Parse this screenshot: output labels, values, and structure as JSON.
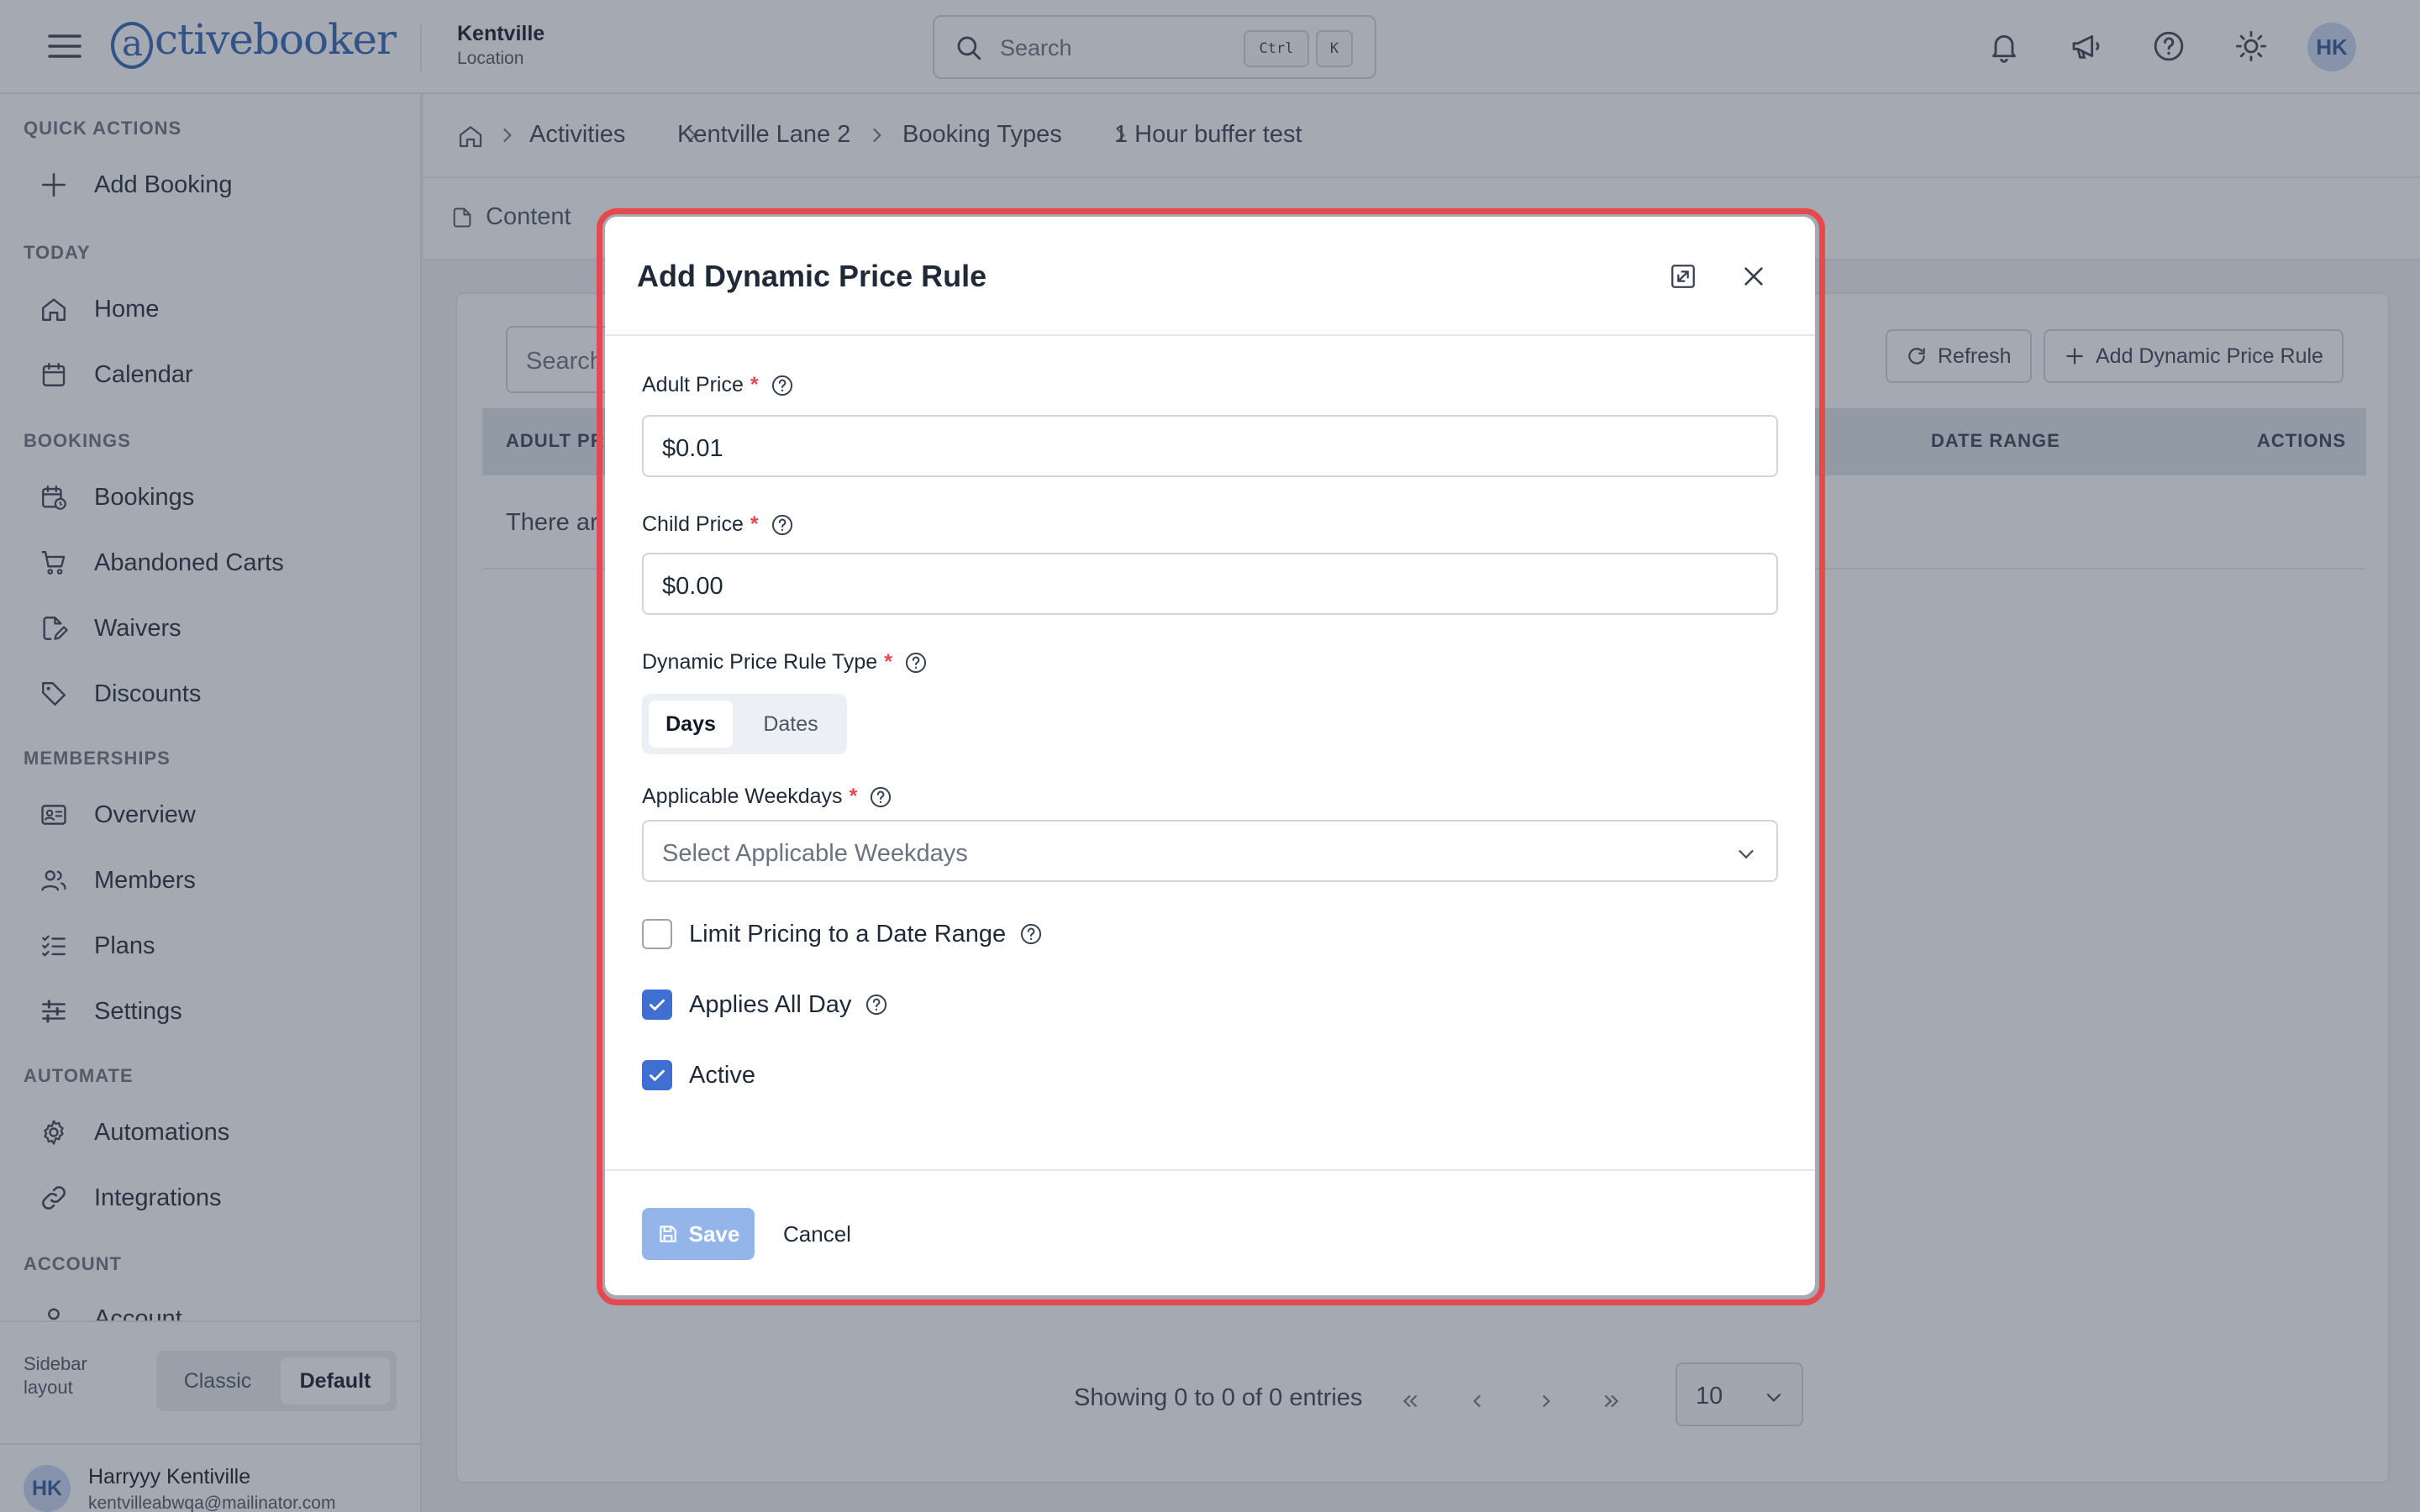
{
  "header": {
    "logo": "activebooker",
    "location_name": "Kentville",
    "location_sub": "Location",
    "search_placeholder": "Search",
    "kbd_ctrl": "Ctrl",
    "kbd_k": "K",
    "avatar": "HK"
  },
  "sidebar": {
    "sections": [
      {
        "title": "QUICK ACTIONS",
        "items": [
          {
            "label": "Add Booking",
            "icon": "plus-icon"
          }
        ]
      },
      {
        "title": "TODAY",
        "items": [
          {
            "label": "Home",
            "icon": "home-icon"
          },
          {
            "label": "Calendar",
            "icon": "calendar-icon"
          }
        ]
      },
      {
        "title": "BOOKINGS",
        "items": [
          {
            "label": "Bookings",
            "icon": "calendar-clock-icon"
          },
          {
            "label": "Abandoned Carts",
            "icon": "cart-icon"
          },
          {
            "label": "Waivers",
            "icon": "document-signature-icon"
          },
          {
            "label": "Discounts",
            "icon": "tag-icon"
          }
        ]
      },
      {
        "title": "MEMBERSHIPS",
        "items": [
          {
            "label": "Overview",
            "icon": "id-card-icon"
          },
          {
            "label": "Members",
            "icon": "users-icon"
          },
          {
            "label": "Plans",
            "icon": "list-check-icon"
          },
          {
            "label": "Settings",
            "icon": "sliders-icon"
          }
        ]
      },
      {
        "title": "AUTOMATE",
        "items": [
          {
            "label": "Automations",
            "icon": "gear-icon"
          },
          {
            "label": "Integrations",
            "icon": "link-icon"
          }
        ]
      },
      {
        "title": "ACCOUNT",
        "items": [
          {
            "label": "Account",
            "icon": "user-icon"
          }
        ]
      }
    ],
    "layout_label": "Sidebar layout",
    "layout_classic": "Classic",
    "layout_default": "Default",
    "user_avatar": "HK",
    "user_name": "Harryyy Kentiville",
    "user_email": "kentvilleabwqa@mailinator.com"
  },
  "breadcrumb": [
    "Activities",
    "Kentville Lane 2",
    "Booking Types",
    "1 Hour buffer test"
  ],
  "tabs": [
    "Content"
  ],
  "table": {
    "search_placeholder": "Search",
    "refresh_label": "Refresh",
    "add_label": "Add Dynamic Price Rule",
    "col_adult": "ADULT PR",
    "col_date_range": "DATE RANGE",
    "col_actions": "ACTIONS",
    "empty_text": "There ar",
    "showing": "Showing 0 to 0 of 0 entries",
    "per_page": "10"
  },
  "modal": {
    "title": "Add Dynamic Price Rule",
    "adult_label": "Adult Price",
    "adult_value": "$0.01",
    "child_label": "Child Price",
    "child_value": "$0.00",
    "rule_type_label": "Dynamic Price Rule Type",
    "rule_type_days": "Days",
    "rule_type_dates": "Dates",
    "rule_type_selected": "Days",
    "weekdays_label": "Applicable Weekdays",
    "weekdays_placeholder": "Select Applicable Weekdays",
    "limit_label": "Limit Pricing to a Date Range",
    "limit_checked": false,
    "all_day_label": "Applies All Day",
    "all_day_checked": true,
    "active_label": "Active",
    "active_checked": true,
    "save_label": "Save",
    "cancel_label": "Cancel"
  },
  "colors": {
    "accent": "#3f6fd1",
    "required": "#e5484d",
    "highlight_outline": "#e5484d",
    "logo": "#2f63b5"
  }
}
